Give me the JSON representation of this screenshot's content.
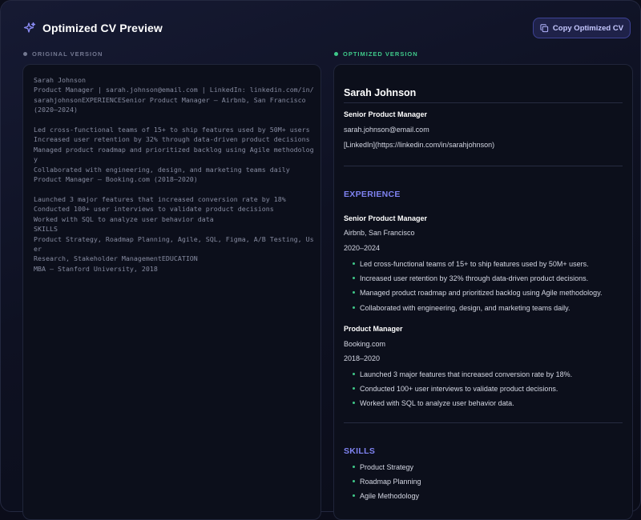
{
  "header": {
    "title": "Optimized CV Preview",
    "copy_button_label": "Copy Optimized CV",
    "title_icon": "sparkle-icon",
    "copy_icon": "copy-icon"
  },
  "original": {
    "label": "ORIGINAL VERSION",
    "text": "Sarah Johnson\nProduct Manager | sarah.johnson@email.com | LinkedIn: linkedin.com/in/\nsarahjohnsonEXPERIENCESenior Product Manager – Airbnb, San Francisco\n(2020–2024)\n\nLed cross-functional teams of 15+ to ship features used by 50M+ users\nIncreased user retention by 32% through data-driven product decisions\nManaged product roadmap and prioritized backlog using Agile methodology\nCollaborated with engineering, design, and marketing teams daily\nProduct Manager – Booking.com (2018–2020)\n\nLaunched 3 major features that increased conversion rate by 18%\nConducted 100+ user interviews to validate product decisions\nWorked with SQL to analyze user behavior data\nSKILLS\nProduct Strategy, Roadmap Planning, Agile, SQL, Figma, A/B Testing, User\nResearch, Stakeholder ManagementEDUCATION\nMBA – Stanford University, 2018"
  },
  "optimized": {
    "label": "OPTIMIZED VERSION",
    "name": "Sarah Johnson",
    "headline": "Senior Product Manager",
    "email": "sarah.johnson@email.com",
    "linkedin": "[LinkedIn](https://linkedin.com/in/sarahjohnson)",
    "experience_heading": "EXPERIENCE",
    "jobs": [
      {
        "title": "Senior Product Manager",
        "company": "Airbnb, San Francisco",
        "dates": "2020–2024",
        "bullets": [
          "Led cross-functional teams of 15+ to ship features used by 50M+ users.",
          "Increased user retention by 32% through data-driven product decisions.",
          "Managed product roadmap and prioritized backlog using Agile methodology.",
          "Collaborated with engineering, design, and marketing teams daily."
        ]
      },
      {
        "title": "Product Manager",
        "company": "Booking.com",
        "dates": "2018–2020",
        "bullets": [
          "Launched 3 major features that increased conversion rate by 18%.",
          "Conducted 100+ user interviews to validate product decisions.",
          "Worked with SQL to analyze user behavior data."
        ]
      }
    ],
    "skills_heading": "SKILLS",
    "skills": [
      "Product Strategy",
      "Roadmap Planning",
      "Agile Methodology"
    ]
  },
  "colors": {
    "accent": "#7f83f2",
    "optimized_green": "#3fc98a",
    "background": "#0b0d1a"
  }
}
